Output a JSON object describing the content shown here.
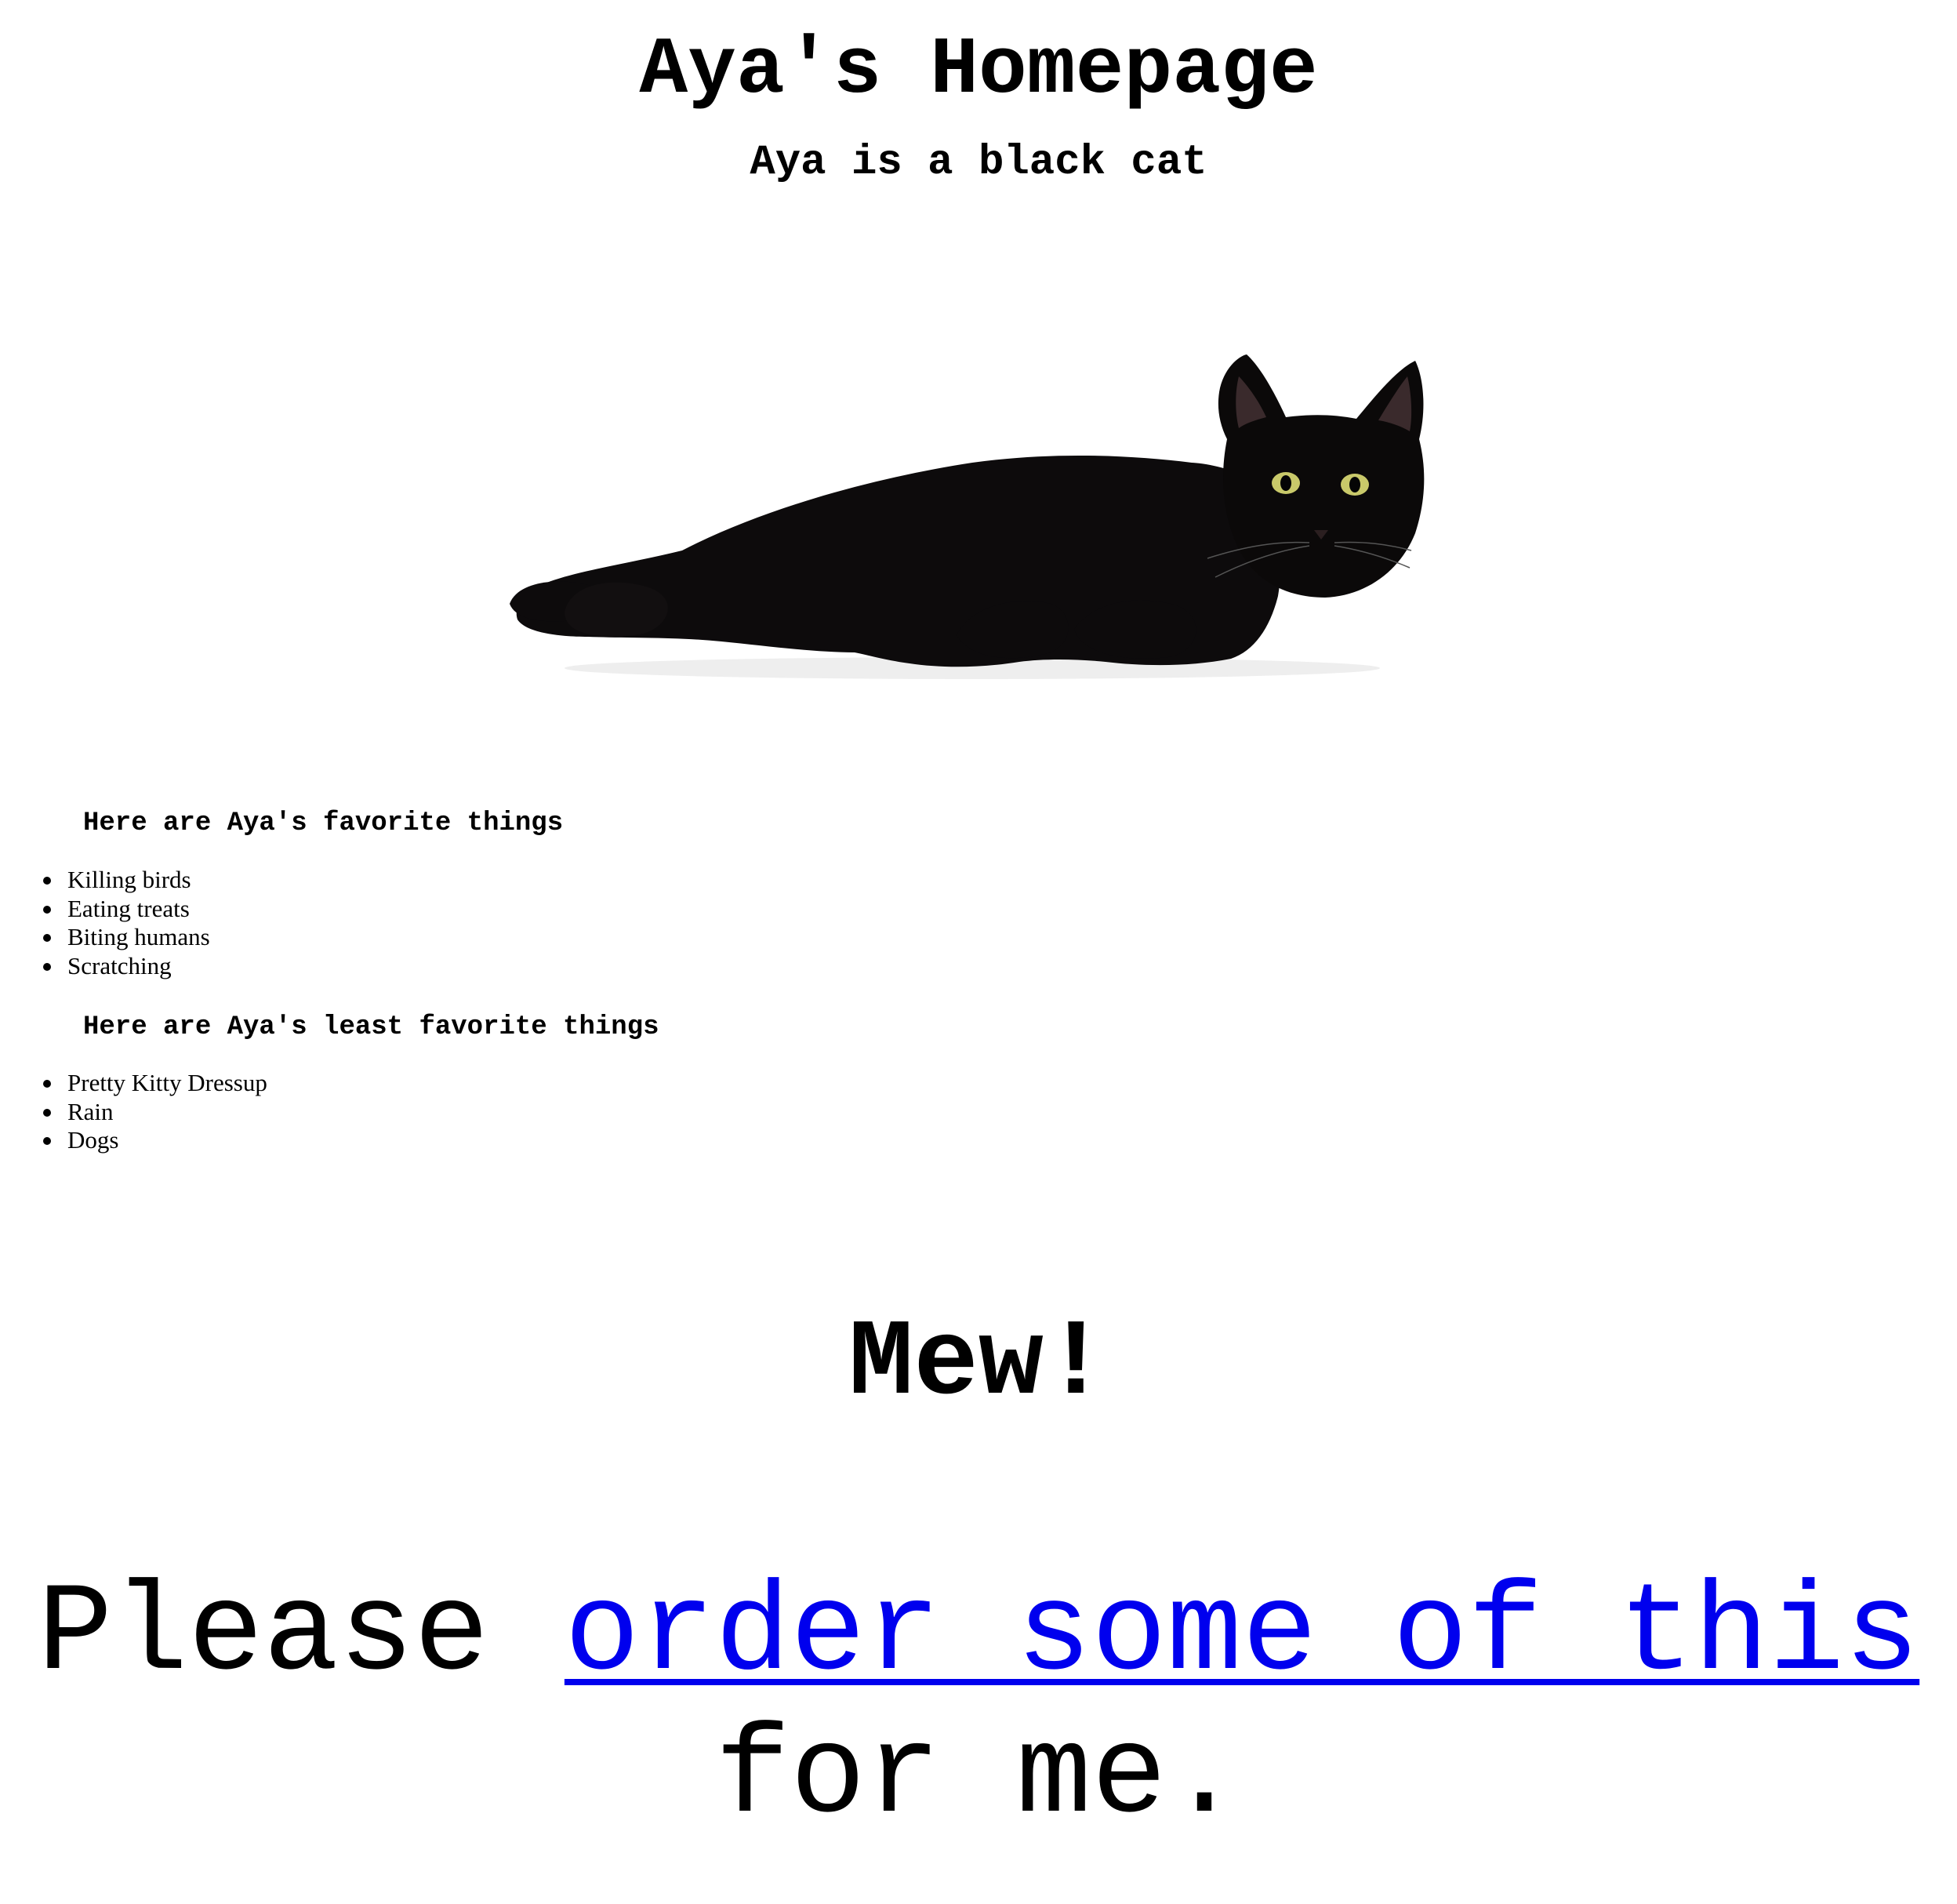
{
  "header": {
    "title": "Aya's Homepage",
    "subtitle": "Aya is a black cat"
  },
  "photo": {
    "alt_icon": "black-cat-photo",
    "eye_color": "#c9c96a"
  },
  "favorites": {
    "heading": "Here are Aya's favorite things",
    "items": [
      "Killing birds",
      "Eating treats",
      "Biting humans",
      "Scratching"
    ]
  },
  "least_favorites": {
    "heading": "Here are Aya's least favorite things",
    "items": [
      "Pretty Kitty Dressup",
      "Rain",
      "Dogs"
    ]
  },
  "mew": "Mew!",
  "plea": {
    "before": "Please ",
    "link_text": "order some of this",
    "after": " for me."
  },
  "colors": {
    "link": "#0000ee",
    "text": "#000000",
    "background": "#ffffff"
  }
}
